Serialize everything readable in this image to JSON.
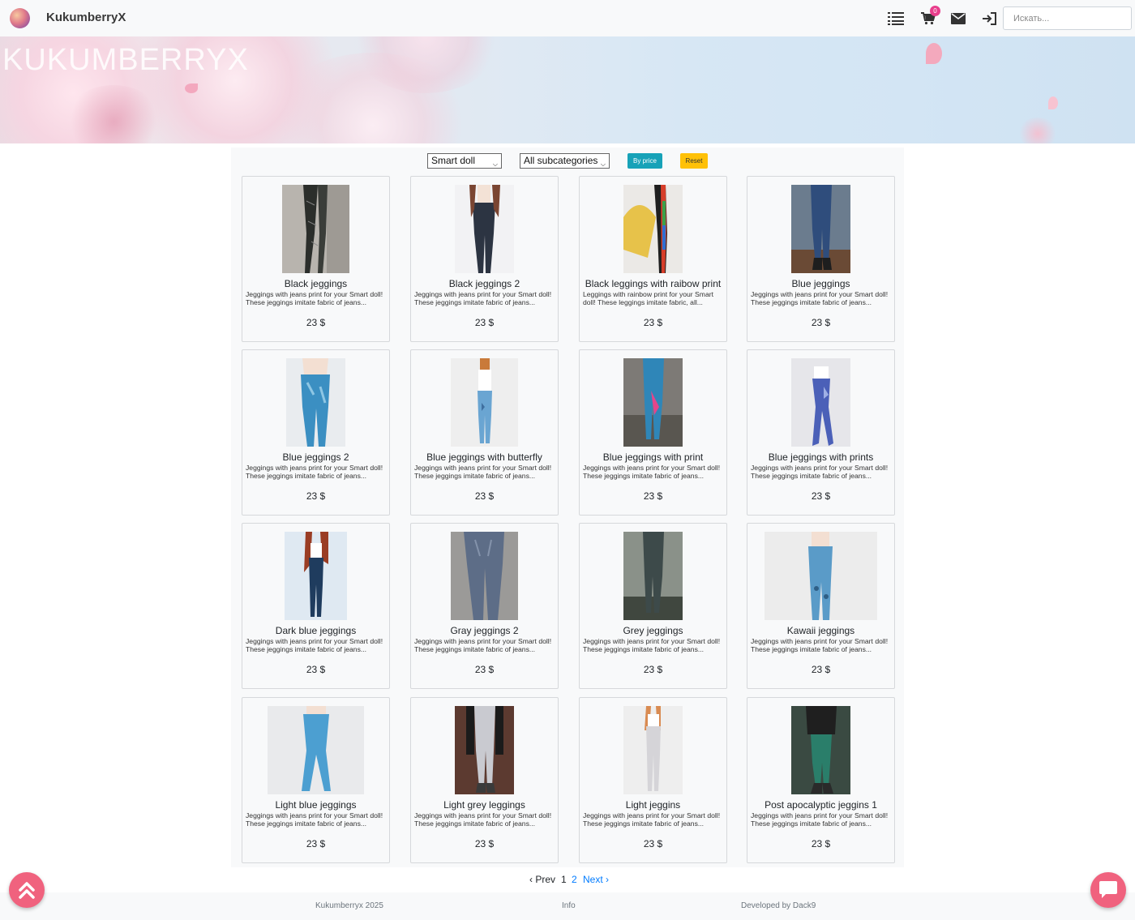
{
  "brand": {
    "name": "KukumberryX",
    "banner_text": "KUKUMBERRYX"
  },
  "navbar": {
    "icons": [
      "list-icon",
      "cart-icon",
      "mail-icon",
      "login-icon"
    ],
    "cart_count": "0",
    "search_placeholder": "Искать..."
  },
  "filters": {
    "category_selected": "Smart doll",
    "subcategory_selected": "All subcategories",
    "by_price_label": "By price",
    "reset_label": "Reset"
  },
  "products": [
    {
      "name": "Black jeggings",
      "desc": "Jeggings with jeans print for your Smart doll! These jeggings imitate fabric of jeans...",
      "price": "23 $"
    },
    {
      "name": "Black jeggings 2",
      "desc": "Jeggings with jeans print for your Smart doll! These jeggings imitate fabric of jeans...",
      "price": "23 $"
    },
    {
      "name": "Black leggings with raibow print",
      "desc": "Leggings with rainbow print for your Smart doll! These leggings imitate fabric, all...",
      "price": "23 $"
    },
    {
      "name": "Blue jeggings",
      "desc": "Jeggings with jeans print for your Smart doll! These jeggings imitate fabric of jeans...",
      "price": "23 $"
    },
    {
      "name": "Blue jeggings 2",
      "desc": "Jeggings with jeans print for your Smart doll! These jeggings imitate fabric of jeans...",
      "price": "23 $"
    },
    {
      "name": "Blue jeggings with butterfly",
      "desc": "Jeggings with jeans print for your Smart doll! These jeggings imitate fabric of jeans...",
      "price": "23 $"
    },
    {
      "name": "Blue jeggings with print",
      "desc": "Jeggings with jeans print for your Smart doll! These jeggings imitate fabric of jeans...",
      "price": "23 $"
    },
    {
      "name": "Blue jeggings with prints",
      "desc": "Jeggings with jeans print for your Smart doll! These jeggings imitate fabric of jeans...",
      "price": "23 $"
    },
    {
      "name": "Dark blue jeggings",
      "desc": "Jeggings with jeans print for your Smart doll! These jeggings imitate fabric of jeans...",
      "price": "23 $"
    },
    {
      "name": "Gray jeggings 2",
      "desc": "Jeggings with jeans print for your Smart doll! These jeggings imitate fabric of jeans...",
      "price": "23 $"
    },
    {
      "name": "Grey jeggings",
      "desc": "Jeggings with jeans print for your Smart doll! These jeggings imitate fabric of jeans...",
      "price": "23 $"
    },
    {
      "name": "Kawaii jeggings",
      "desc": "Jeggings with jeans print for your Smart doll! These jeggings imitate fabric of jeans...",
      "price": "23 $"
    },
    {
      "name": "Light blue jeggings",
      "desc": "Jeggings with jeans print for your Smart doll! These jeggings imitate fabric of jeans...",
      "price": "23 $"
    },
    {
      "name": "Light grey leggings",
      "desc": "Jeggings with jeans print for your Smart doll! These jeggings imitate fabric of jeans...",
      "price": "23 $"
    },
    {
      "name": "Light jeggins",
      "desc": "Jeggings with jeans print for your Smart doll! These jeggings imitate fabric of jeans...",
      "price": "23 $"
    },
    {
      "name": "Post apocalyptic jeggins 1",
      "desc": "Jeggings with jeans print for your Smart doll! These jeggings imitate fabric of jeans...",
      "price": "23 $"
    }
  ],
  "pagination": {
    "prev": "‹ Prev",
    "page1": "1",
    "page2": "2",
    "next": "Next ›"
  },
  "footer": {
    "copyright": "Kukumberryx 2025",
    "info": "Info",
    "developer": "Developed by Dack9"
  },
  "colors": {
    "accent_teal": "#17a2b8",
    "accent_yellow": "#ffc107",
    "badge_pink": "#e83e8c",
    "fab_pink": "#f0627e",
    "link_blue": "#007bff"
  }
}
